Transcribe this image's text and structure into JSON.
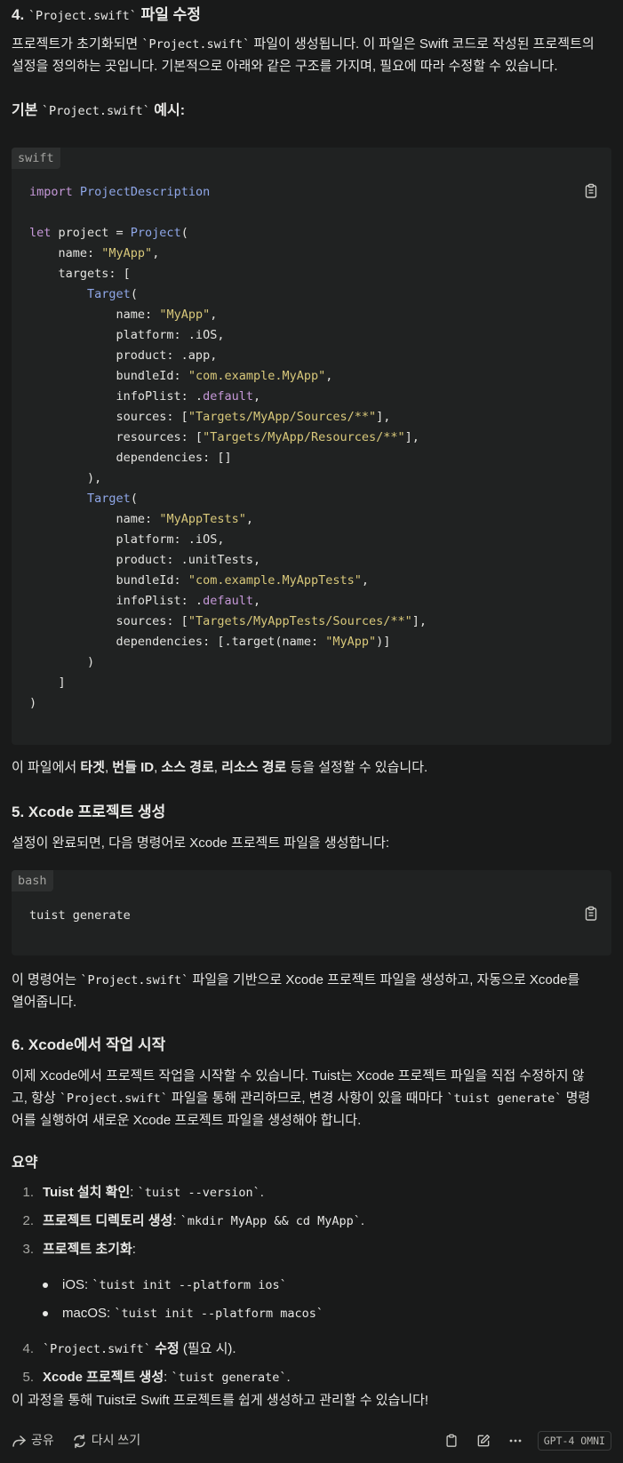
{
  "section4": {
    "heading_num": "4.",
    "heading_code": "`Project.swift`",
    "heading_rest": "파일 수정",
    "para_a": "프로젝트가 초기화되면",
    "para_code": "`Project.swift`",
    "para_b": "파일이 생성됩니다. 이 파일은 Swift 코드로 작성된 프로젝트의",
    "para_line2": "설정을 정의하는 곳입니다. 기본적으로 아래와 같은 구조를 가지며, 필요에 따라 수정할 수 있습니다.",
    "example_a": "기본",
    "example_code": "`Project.swift`",
    "example_b": "예시:"
  },
  "code_swift": {
    "lang": "swift",
    "lines": [
      [
        [
          "k",
          "import"
        ],
        [
          "p",
          " "
        ],
        [
          "t",
          "ProjectDescription"
        ]
      ],
      [],
      [
        [
          "k",
          "let"
        ],
        [
          "p",
          " project = "
        ],
        [
          "t",
          "Project"
        ],
        [
          "p",
          "("
        ]
      ],
      [
        [
          "p",
          "    name: "
        ],
        [
          "s",
          "\"MyApp\""
        ],
        [
          "p",
          ","
        ]
      ],
      [
        [
          "p",
          "    targets: ["
        ]
      ],
      [
        [
          "p",
          "        "
        ],
        [
          "t",
          "Target"
        ],
        [
          "p",
          "("
        ]
      ],
      [
        [
          "p",
          "            name: "
        ],
        [
          "s",
          "\"MyApp\""
        ],
        [
          "p",
          ","
        ]
      ],
      [
        [
          "p",
          "            platform: .iOS,"
        ]
      ],
      [
        [
          "p",
          "            product: .app,"
        ]
      ],
      [
        [
          "p",
          "            bundleId: "
        ],
        [
          "s",
          "\"com.example.MyApp\""
        ],
        [
          "p",
          ","
        ]
      ],
      [
        [
          "p",
          "            infoPlist: ."
        ],
        [
          "k",
          "default"
        ],
        [
          "p",
          ","
        ]
      ],
      [
        [
          "p",
          "            sources: ["
        ],
        [
          "s",
          "\"Targets/MyApp/Sources/**\""
        ],
        [
          "p",
          "],"
        ]
      ],
      [
        [
          "p",
          "            resources: ["
        ],
        [
          "s",
          "\"Targets/MyApp/Resources/**\""
        ],
        [
          "p",
          "],"
        ]
      ],
      [
        [
          "p",
          "            dependencies: []"
        ]
      ],
      [
        [
          "p",
          "        ),"
        ]
      ],
      [
        [
          "p",
          "        "
        ],
        [
          "t",
          "Target"
        ],
        [
          "p",
          "("
        ]
      ],
      [
        [
          "p",
          "            name: "
        ],
        [
          "s",
          "\"MyAppTests\""
        ],
        [
          "p",
          ","
        ]
      ],
      [
        [
          "p",
          "            platform: .iOS,"
        ]
      ],
      [
        [
          "p",
          "            product: .unitTests,"
        ]
      ],
      [
        [
          "p",
          "            bundleId: "
        ],
        [
          "s",
          "\"com.example.MyAppTests\""
        ],
        [
          "p",
          ","
        ]
      ],
      [
        [
          "p",
          "            infoPlist: ."
        ],
        [
          "k",
          "default"
        ],
        [
          "p",
          ","
        ]
      ],
      [
        [
          "p",
          "            sources: ["
        ],
        [
          "s",
          "\"Targets/MyAppTests/Sources/**\""
        ],
        [
          "p",
          "],"
        ]
      ],
      [
        [
          "p",
          "            dependencies: [.target(name: "
        ],
        [
          "s",
          "\"MyApp\""
        ],
        [
          "p",
          ")]"
        ]
      ],
      [
        [
          "p",
          "        )"
        ]
      ],
      [
        [
          "p",
          "    ]"
        ]
      ],
      [
        [
          "p",
          ")"
        ]
      ]
    ]
  },
  "after_code": {
    "a": "이 파일에서",
    "b1": "타겟",
    "c1": ",",
    "b2": "번들 ID",
    "c2": ",",
    "b3": "소스 경로",
    "c3": ",",
    "b4": "리소스 경로",
    "d": "등을 설정할 수 있습니다."
  },
  "section5": {
    "heading_num": "5.",
    "heading_rest": "Xcode 프로젝트 생성",
    "para": "설정이 완료되면, 다음 명령어로 Xcode 프로젝트 파일을 생성합니다:",
    "after_a": "이 명령어는",
    "after_code": "`Project.swift`",
    "after_b": "파일을 기반으로 Xcode 프로젝트 파일을 생성하고, 자동으로 Xcode를",
    "after_line2": "열어줍니다."
  },
  "code_bash": {
    "lang": "bash",
    "text": "tuist generate"
  },
  "section6": {
    "heading_num": "6.",
    "heading_rest": "Xcode에서 작업 시작",
    "line1": "이제 Xcode에서 프로젝트 작업을 시작할 수 있습니다. Tuist는 Xcode 프로젝트 파일을 직접 수정하지 않",
    "line2_a": "고, 항상",
    "line2_code1": "`Project.swift`",
    "line2_b": "파일을 통해 관리하므로, 변경 사항이 있을 때마다",
    "line2_code2": "`tuist generate`",
    "line2_c": "명령",
    "line3": "어를 실행하여 새로운 Xcode 프로젝트 파일을 생성해야 합니다."
  },
  "summary": {
    "heading": "요약",
    "items": [
      {
        "num": "1.",
        "bold": "Tuist 설치 확인",
        "rest": ": ",
        "code": "`tuist --version`",
        "tail": "."
      },
      {
        "num": "2.",
        "bold": "프로젝트 디렉토리 생성",
        "rest": ": ",
        "code": "`mkdir MyApp && cd MyApp`",
        "tail": "."
      },
      {
        "num": "3.",
        "bold": "프로젝트 초기화",
        "rest": ":",
        "code": "",
        "tail": ""
      }
    ],
    "sub_items": [
      {
        "label": "iOS: ",
        "code": "`tuist init --platform ios`"
      },
      {
        "label": "macOS: ",
        "code": "`tuist init --platform macos`"
      }
    ],
    "items2": [
      {
        "num": "4.",
        "code": "`Project.swift`",
        "bold": "수정",
        "rest": " (필요 시)."
      },
      {
        "num": "5.",
        "bold": "Xcode 프로젝트 생성",
        "rest": ": ",
        "code": "`tuist generate`",
        "tail": "."
      }
    ],
    "closing": "이 과정을 통해 Tuist로 Swift 프로젝트를 쉽게 생성하고 관리할 수 있습니다!"
  },
  "bottom_bar": {
    "share": "공유",
    "rewrite": "다시 쓰기",
    "model": "GPT-4 OMNI",
    "icons": [
      "share-icon",
      "rewrite-icon",
      "clipboard-icon",
      "edit-icon",
      "more-icon"
    ]
  },
  "colors": {
    "background": "#191a1a",
    "code_bg": "#202222",
    "keyword": "#c598d8",
    "type": "#8fa7e8",
    "string": "#d8c87a"
  }
}
